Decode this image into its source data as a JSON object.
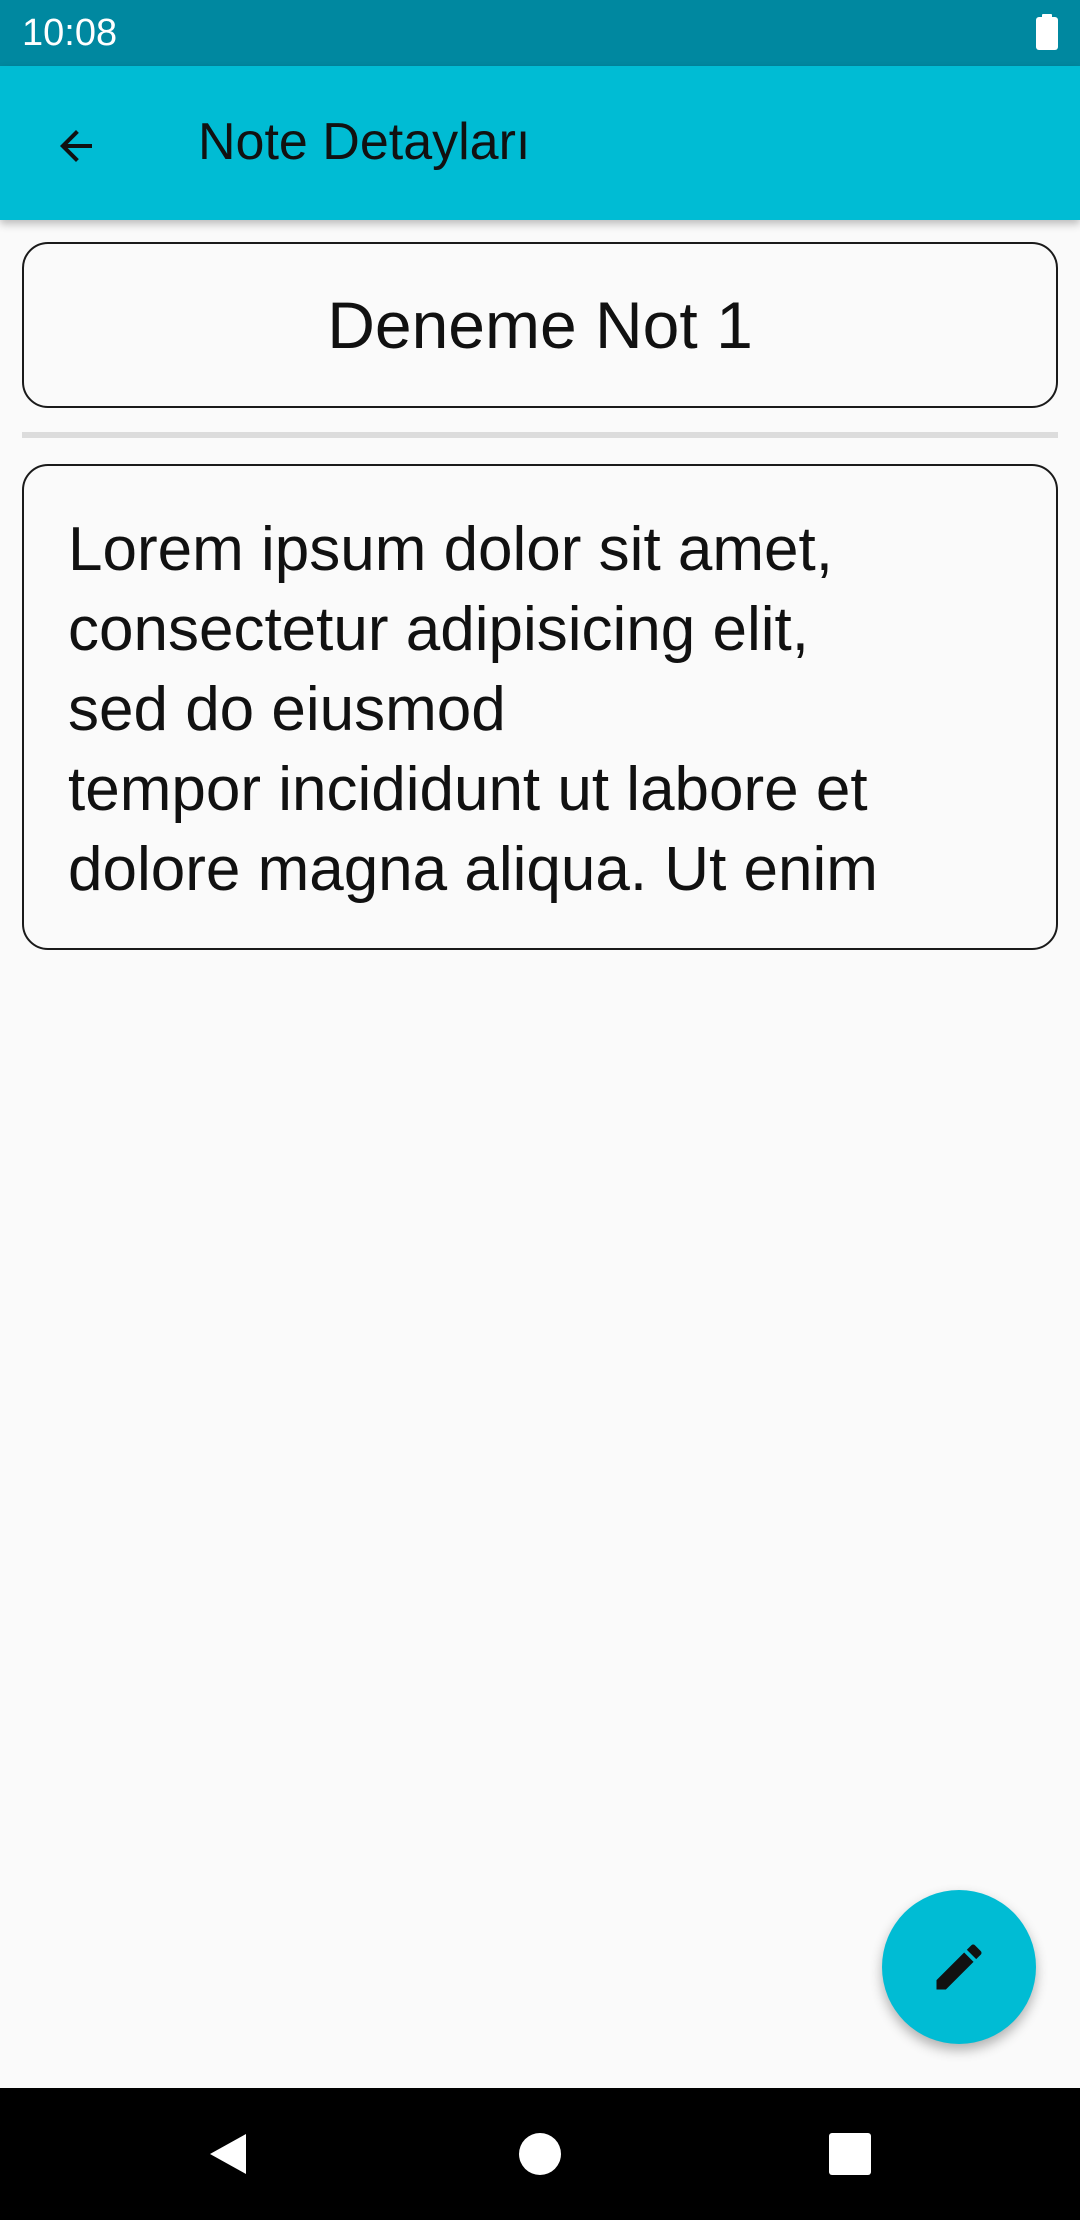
{
  "status_bar": {
    "time": "10:08",
    "battery_icon": "battery-full-icon"
  },
  "app_bar": {
    "back_icon": "arrow-back-icon",
    "title": "Note Detayları",
    "color": "#00bcd4"
  },
  "note": {
    "title": "Deneme Not 1",
    "content": "Lorem ipsum dolor sit amet,\nconsectetur adipisicing elit,\nsed do eiusmod\ntempor incididunt ut labore et\ndolore magna aliqua. Ut enim"
  },
  "fab": {
    "icon": "edit-pencil-icon",
    "color": "#00bcd4"
  },
  "nav_bar": {
    "items": [
      "back-triangle-icon",
      "home-circle-icon",
      "recents-square-icon"
    ]
  }
}
